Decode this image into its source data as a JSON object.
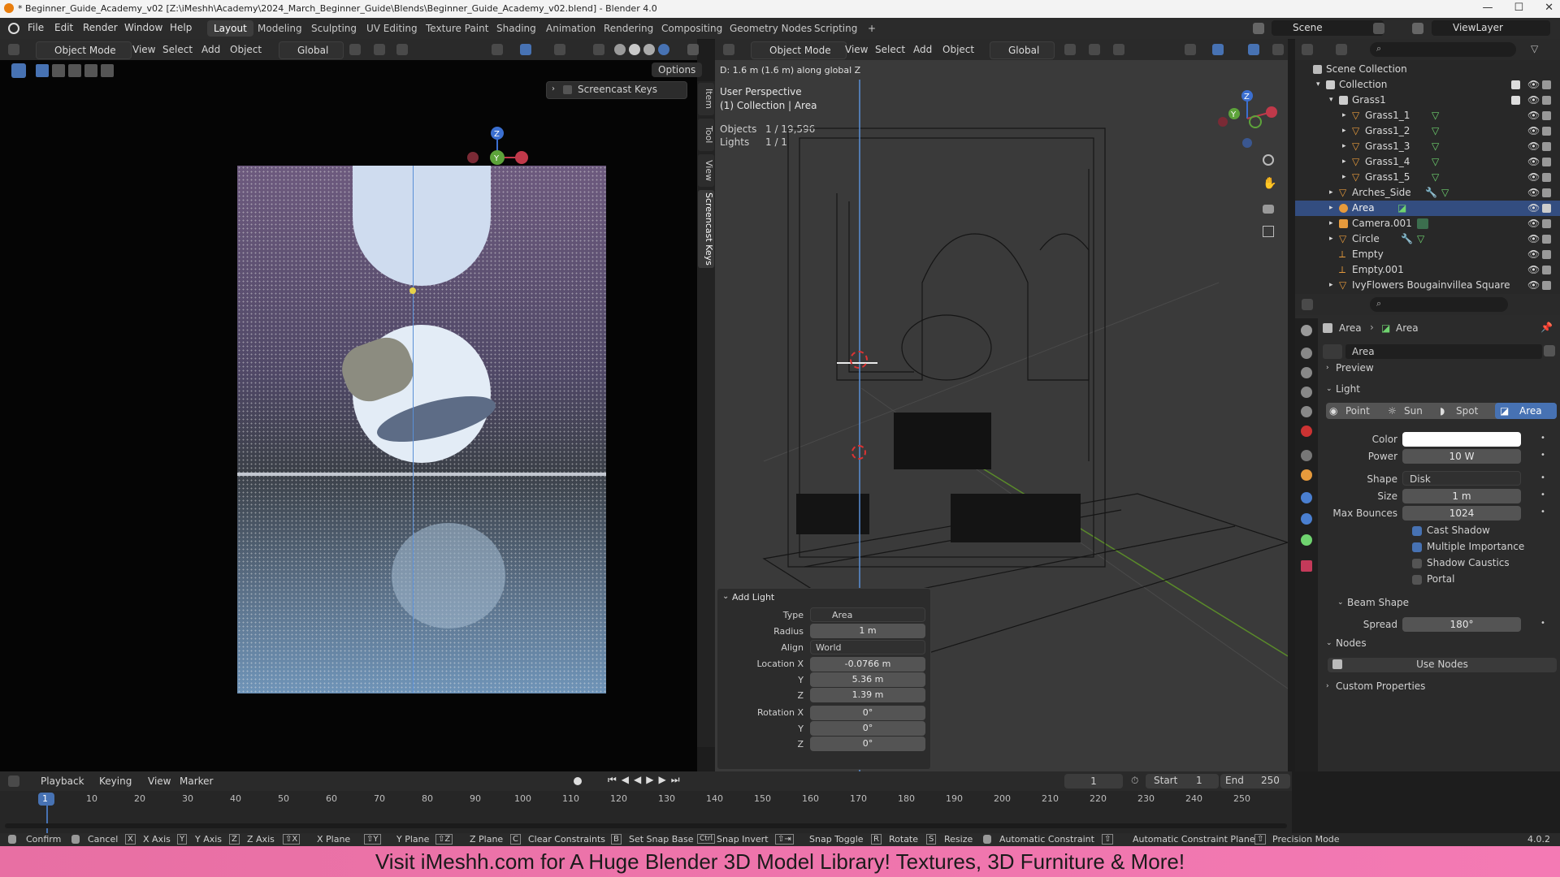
{
  "window": {
    "title": "* Beginner_Guide_Academy_v02 [Z:\\iMeshh\\Academy\\2024_March_Beginner_Guide\\Blends\\Beginner_Guide_Academy_v02.blend] - Blender 4.0"
  },
  "menubar": {
    "menus": [
      "File",
      "Edit",
      "Render",
      "Window",
      "Help"
    ],
    "workspaces": [
      "Layout",
      "Modeling",
      "Sculpting",
      "UV Editing",
      "Texture Paint",
      "Shading",
      "Animation",
      "Rendering",
      "Compositing",
      "Geometry Nodes",
      "Scripting"
    ],
    "active_workspace": "Layout",
    "add_tab": "+",
    "scene": "Scene",
    "view_layer": "ViewLayer"
  },
  "left_viewport": {
    "mode": "Object Mode",
    "menus": [
      "View",
      "Select",
      "Add",
      "Object"
    ],
    "orientation": "Global",
    "options": "Options",
    "screencast_panel": "Screencast Keys",
    "gizmo_labels": {
      "z": "Z",
      "y": "Y"
    }
  },
  "side_tabs": [
    "Item",
    "Tool",
    "View",
    "Screencast Keys"
  ],
  "right_viewport": {
    "mode": "Object Mode",
    "menus": [
      "View",
      "Select",
      "Add",
      "Object"
    ],
    "orientation": "Global",
    "transform_info": "D: 1.6 m (1.6 m) along global Z",
    "perspective": "User Perspective",
    "collection": "(1) Collection | Area",
    "stats": [
      {
        "label": "Objects",
        "value": "1 / 19,596"
      },
      {
        "label": "Lights",
        "value": "1 / 1"
      }
    ],
    "gizmo_labels": {
      "z": "Z",
      "y": "Y"
    }
  },
  "add_light_panel": {
    "title": "Add Light",
    "rows": [
      {
        "label": "Type",
        "value": "Area",
        "kind": "dropdown"
      },
      {
        "label": "Radius",
        "value": "1 m",
        "kind": "field"
      },
      {
        "label": "Align",
        "value": "World",
        "kind": "dropdown"
      },
      {
        "label": "Location X",
        "value": "-0.0766 m",
        "kind": "field"
      },
      {
        "label": "Y",
        "value": "5.36 m",
        "kind": "field"
      },
      {
        "label": "Z",
        "value": "1.39 m",
        "kind": "field"
      },
      {
        "label": "Rotation X",
        "value": "0°",
        "kind": "field"
      },
      {
        "label": "Y",
        "value": "0°",
        "kind": "field"
      },
      {
        "label": "Z",
        "value": "0°",
        "kind": "field"
      }
    ]
  },
  "outliner": {
    "rows": [
      {
        "label": "Scene Collection",
        "indent": 0,
        "icon": "scene-collection-icon"
      },
      {
        "label": "Collection",
        "indent": 1,
        "icon": "collection-icon"
      },
      {
        "label": "Grass1",
        "indent": 2,
        "icon": "collection-icon"
      },
      {
        "label": "Grass1_1",
        "indent": 3,
        "icon": "mesh-icon"
      },
      {
        "label": "Grass1_2",
        "indent": 3,
        "icon": "mesh-icon"
      },
      {
        "label": "Grass1_3",
        "indent": 3,
        "icon": "mesh-icon"
      },
      {
        "label": "Grass1_4",
        "indent": 3,
        "icon": "mesh-icon"
      },
      {
        "label": "Grass1_5",
        "indent": 3,
        "icon": "mesh-icon"
      },
      {
        "label": "Arches_Side",
        "indent": 2,
        "icon": "mesh-icon"
      },
      {
        "label": "Area",
        "indent": 2,
        "icon": "light-icon",
        "selected": true
      },
      {
        "label": "Camera.001",
        "indent": 2,
        "icon": "camera-icon"
      },
      {
        "label": "Circle",
        "indent": 2,
        "icon": "mesh-icon"
      },
      {
        "label": "Empty",
        "indent": 2,
        "icon": "empty-icon"
      },
      {
        "label": "Empty.001",
        "indent": 2,
        "icon": "empty-icon"
      },
      {
        "label": "IvyFlowers Bougainvillea Square",
        "indent": 2,
        "icon": "mesh-icon"
      }
    ]
  },
  "properties": {
    "breadcrumb": [
      "Area",
      "Area"
    ],
    "datablock": "Area",
    "sections": {
      "preview": "Preview",
      "light": "Light",
      "beam_shape": "Beam Shape",
      "nodes": "Nodes",
      "custom": "Custom Properties"
    },
    "light_types": [
      "Point",
      "Sun",
      "Spot",
      "Area"
    ],
    "active_type": "Area",
    "color_label": "Color",
    "color_value": "#ffffff",
    "power_label": "Power",
    "power": "10 W",
    "shape_label": "Shape",
    "shape": "Disk",
    "size_label": "Size",
    "size": "1 m",
    "bounces_label": "Max Bounces",
    "max_bounces": "1024",
    "checkboxes": [
      {
        "label": "Cast Shadow",
        "checked": true
      },
      {
        "label": "Multiple Importance",
        "checked": true
      },
      {
        "label": "Shadow Caustics",
        "checked": false
      },
      {
        "label": "Portal",
        "checked": false
      }
    ],
    "spread_label": "Spread",
    "spread": "180°",
    "use_nodes": "Use Nodes"
  },
  "timeline": {
    "menus": [
      "Playback",
      "Keying",
      "View",
      "Marker"
    ],
    "current_frame": "1",
    "start_label": "Start",
    "start": "1",
    "end_label": "End",
    "end": "250",
    "ruler": [
      "1",
      "10",
      "20",
      "30",
      "40",
      "50",
      "60",
      "70",
      "80",
      "90",
      "100",
      "110",
      "120",
      "130",
      "140",
      "150",
      "160",
      "170",
      "180",
      "190",
      "200",
      "210",
      "220",
      "230",
      "240",
      "250"
    ]
  },
  "statusbar": {
    "items": [
      "Confirm",
      "Cancel",
      "X Axis",
      "Y Axis",
      "Z Axis",
      "X Plane",
      "Y Plane",
      "Z Plane",
      "Clear Constraints",
      "Set Snap Base",
      "Snap Invert",
      "Snap Toggle",
      "Rotate",
      "Resize",
      "Automatic Constraint",
      "Automatic Constraint Plane",
      "Precision Mode"
    ],
    "version": "4.0.2"
  },
  "banner": {
    "text": "Visit iMeshh.com for A Huge Blender 3D Model Library! Textures, 3D Furniture & More!"
  },
  "colors": {
    "accent": "#4772b3",
    "selected_row": "#334d80",
    "banner": "#f07aad"
  }
}
